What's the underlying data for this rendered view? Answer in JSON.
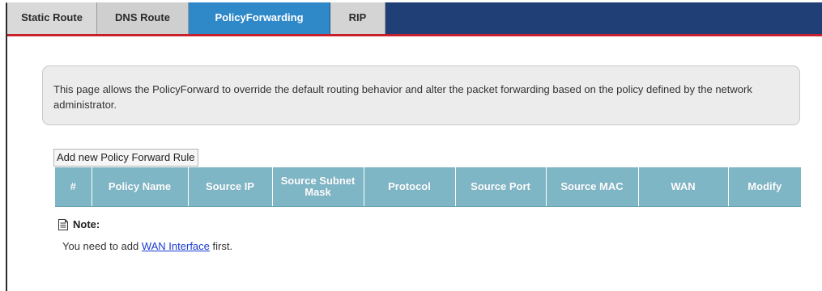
{
  "tabs": [
    {
      "label": "Static Route",
      "active": false
    },
    {
      "label": "DNS Route",
      "active": false
    },
    {
      "label": "PolicyForwarding",
      "active": true
    },
    {
      "label": "RIP",
      "active": false
    }
  ],
  "info": {
    "text": "This page allows the PolicyForward to override the default routing behavior and alter the packet forwarding based on the policy defined by the network administrator."
  },
  "add_button_label": "Add new Policy Forward Rule",
  "table": {
    "columns": [
      "#",
      "Policy Name",
      "Source IP",
      "Source Subnet Mask",
      "Protocol",
      "Source Port",
      "Source MAC",
      "WAN",
      "Modify"
    ],
    "rows": []
  },
  "note": {
    "icon": "document-icon",
    "label": "Note:",
    "text_before": "You need to add ",
    "link_text": "WAN Interface",
    "text_after": " first."
  },
  "colors": {
    "tabbar": "#1f3f76",
    "active_tab": "#2f88c8",
    "tab_underline": "#c8202a",
    "table_header": "#7fb6c6",
    "link": "#1a3ad0"
  }
}
